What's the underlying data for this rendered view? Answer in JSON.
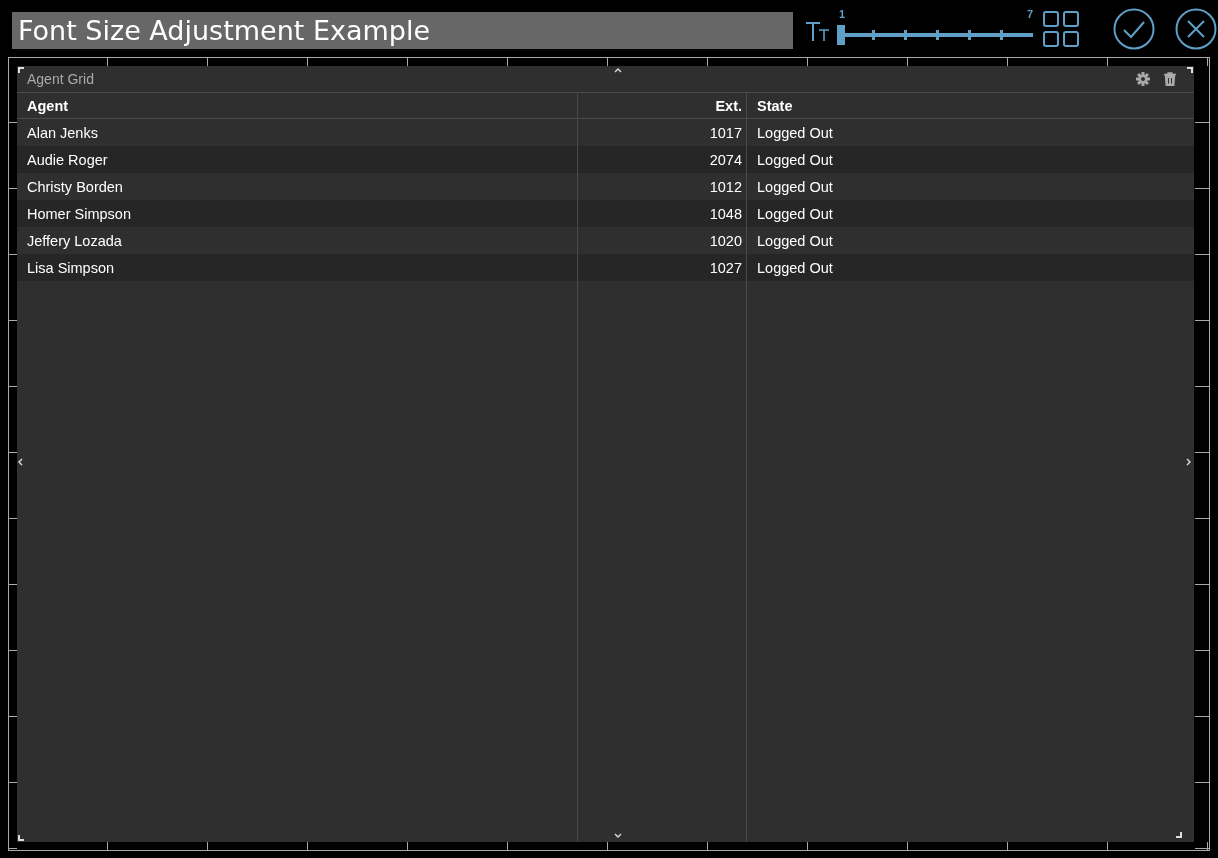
{
  "title_field": {
    "value": "Font Size Adjustment Example"
  },
  "font_size_slider": {
    "min_label": "1",
    "max_label": "7",
    "level": 0
  },
  "panel": {
    "title": "Agent Grid",
    "columns": [
      {
        "label": "Agent"
      },
      {
        "label": "Ext."
      },
      {
        "label": "State"
      }
    ],
    "rows": [
      {
        "cells": [
          "Alan Jenks",
          "1017",
          "Logged Out"
        ]
      },
      {
        "cells": [
          "Audie Roger",
          "2074",
          "Logged Out"
        ]
      },
      {
        "cells": [
          "Christy Borden",
          "1012",
          "Logged Out"
        ]
      },
      {
        "cells": [
          "Homer Simpson",
          "1048",
          "Logged Out"
        ]
      },
      {
        "cells": [
          "Jeffery Lozada",
          "1020",
          "Logged Out"
        ]
      },
      {
        "cells": [
          "Lisa Simpson",
          "1027",
          "Logged Out"
        ]
      }
    ]
  }
}
